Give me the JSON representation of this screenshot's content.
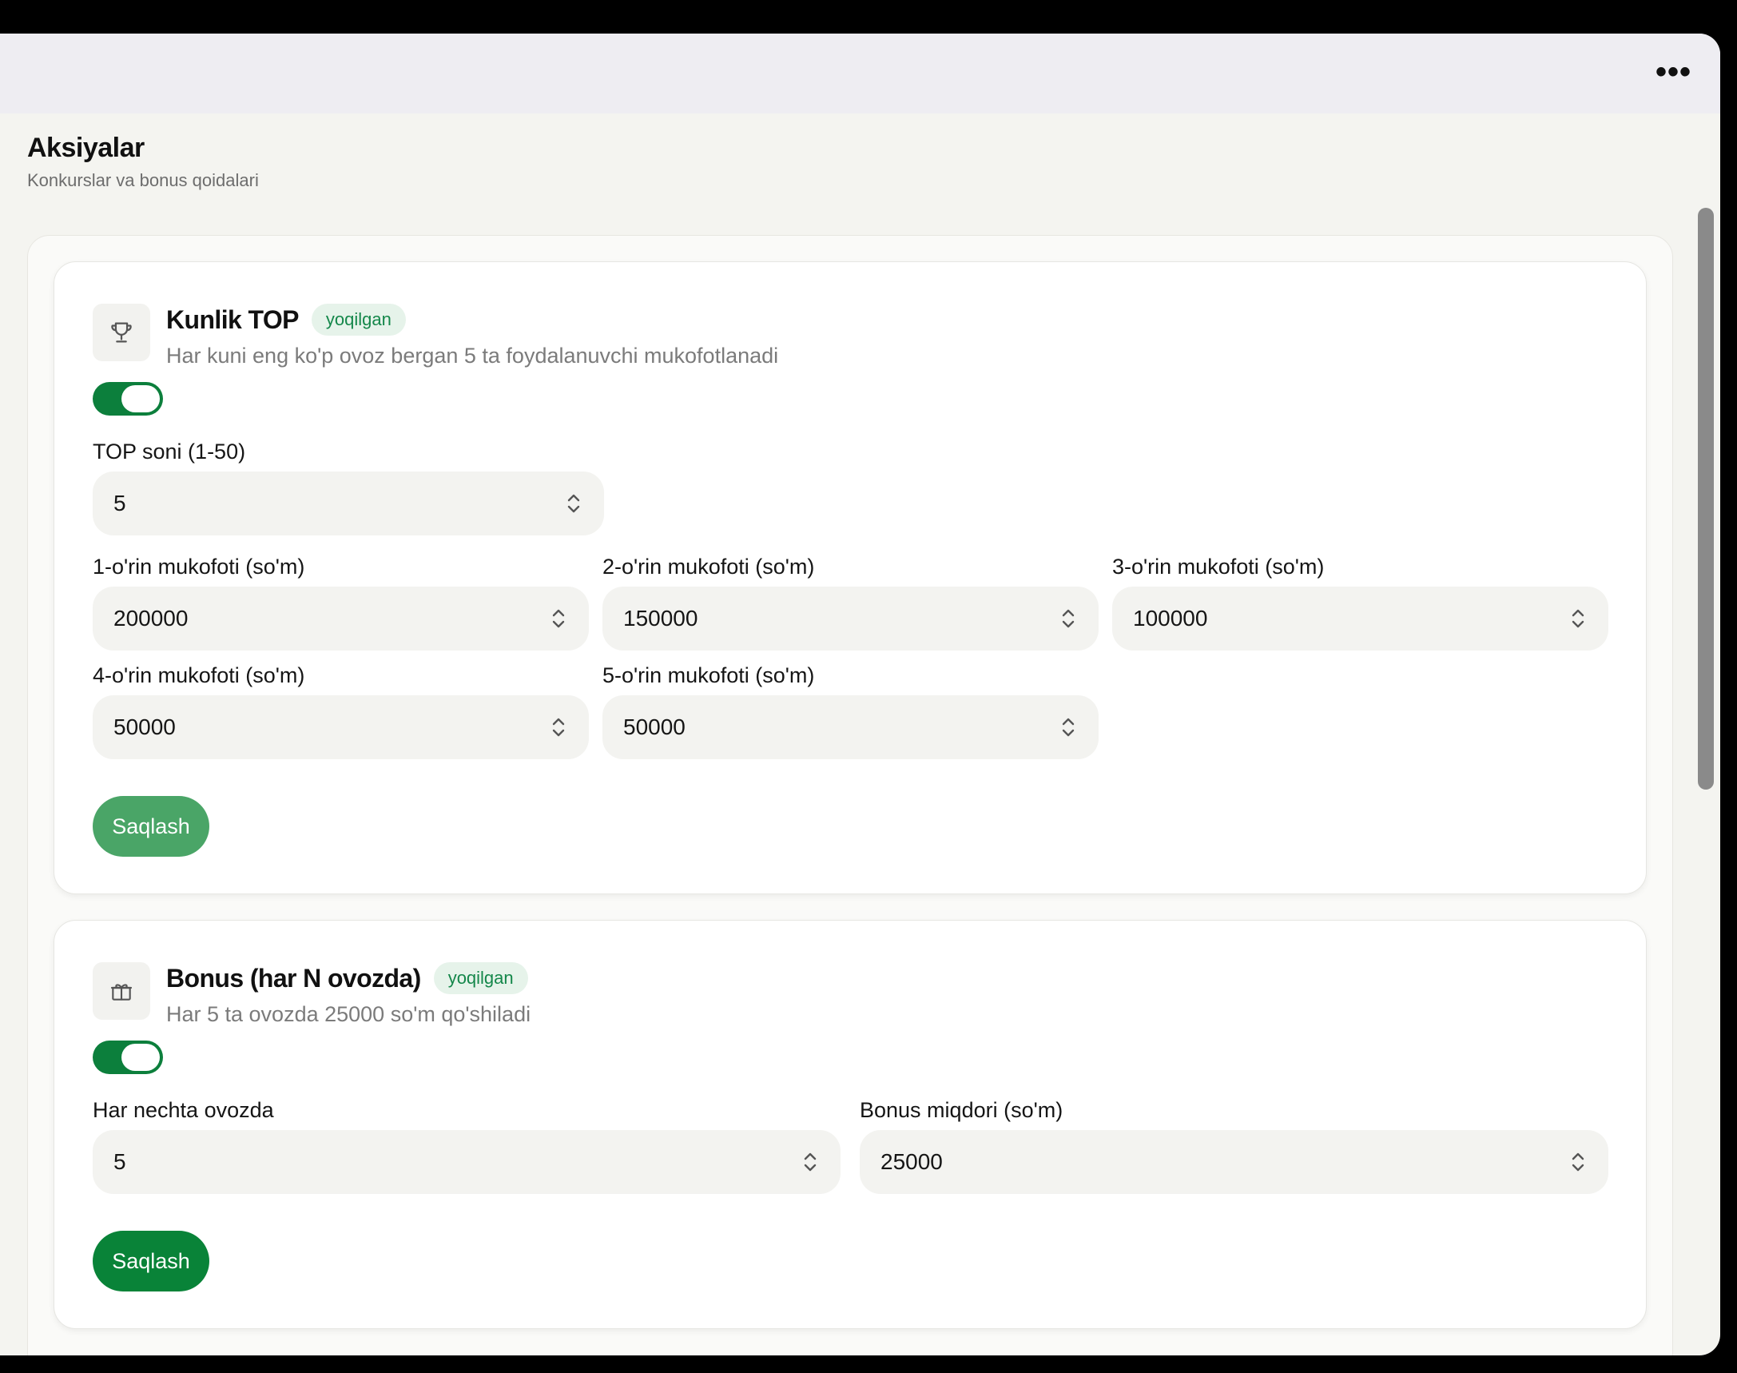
{
  "page": {
    "title": "Aksiyalar",
    "subtitle": "Konkurslar va bonus qoidalari"
  },
  "top_bar": {
    "menu_label": "•••"
  },
  "promo_top": {
    "icon": "trophy-icon",
    "title": "Kunlik TOP",
    "badge": "yoqilgan",
    "description": "Har kuni eng ko'p ovoz bergan 5 ta foydalanuvchi mukofotlanadi",
    "enabled": true,
    "top_count": {
      "label": "TOP soni (1-50)",
      "value": "5"
    },
    "prizes": [
      {
        "label": "1-o'rin mukofoti (so'm)",
        "value": "200000"
      },
      {
        "label": "2-o'rin mukofoti (so'm)",
        "value": "150000"
      },
      {
        "label": "3-o'rin mukofoti (so'm)",
        "value": "100000"
      },
      {
        "label": "4-o'rin mukofoti (so'm)",
        "value": "50000"
      },
      {
        "label": "5-o'rin mukofoti (so'm)",
        "value": "50000"
      }
    ],
    "save_label": "Saqlash"
  },
  "promo_bonus": {
    "icon": "gift-icon",
    "title": "Bonus (har N ovozda)",
    "badge": "yoqilgan",
    "description": "Har 5 ta ovozda 25000 so'm qo'shiladi",
    "enabled": true,
    "every_n": {
      "label": "Har nechta ovozda",
      "value": "5"
    },
    "bonus_amount": {
      "label": "Bonus miqdori (so'm)",
      "value": "25000"
    },
    "save_label": "Saqlash"
  },
  "colors": {
    "accent": "#098338",
    "badge_bg": "#e6f3ea",
    "badge_text": "#14874a",
    "disabled_button": "#4aa567"
  }
}
